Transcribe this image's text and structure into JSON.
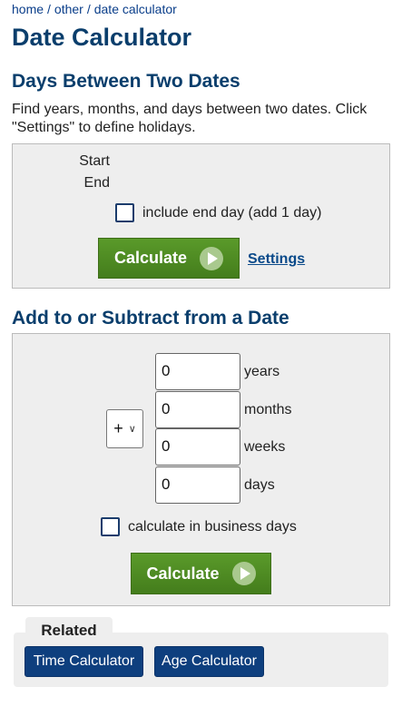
{
  "breadcrumb": {
    "items": [
      "home",
      "other",
      "date calculator"
    ],
    "separator": "/"
  },
  "page_title": "Date Calculator",
  "section1": {
    "heading": "Days Between Two Dates",
    "description": "Find years, months, and days between two dates. Click \"Settings\" to define holidays.",
    "start_label": "Start",
    "end_label": "End",
    "include_end_day_label": "include end day (add 1 day)",
    "include_end_day_checked": false,
    "calculate_label": "Calculate",
    "settings_label": "Settings"
  },
  "section2": {
    "heading": "Add to or Subtract from a Date",
    "operator": "+",
    "fields": [
      {
        "value": "0",
        "unit": "years"
      },
      {
        "value": "0",
        "unit": "months"
      },
      {
        "value": "0",
        "unit": "weeks"
      },
      {
        "value": "0",
        "unit": "days"
      }
    ],
    "business_days_label": "calculate in business days",
    "business_days_checked": false,
    "calculate_label": "Calculate"
  },
  "related": {
    "tab_label": "Related",
    "links": [
      "Time Calculator",
      "Age Calculator"
    ]
  },
  "colors": {
    "heading": "#0a3e6c",
    "button_green": "#4e8a22",
    "link_blue": "#0e3f7e",
    "panel_bg": "#eeeeee"
  }
}
